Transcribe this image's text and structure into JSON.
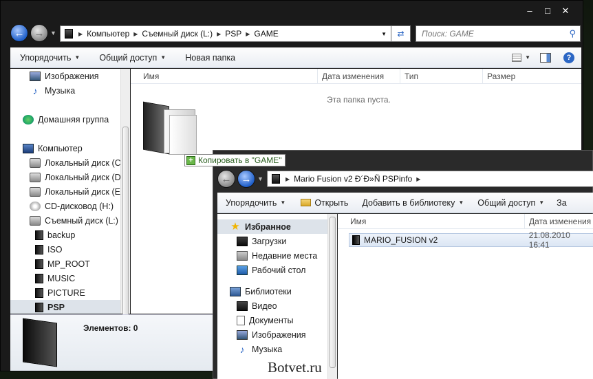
{
  "back_window": {
    "address": {
      "crumbs": [
        "Компьютер",
        "Съемный диск (L:)",
        "PSP",
        "GAME"
      ]
    },
    "search": {
      "placeholder": "Поиск: GAME"
    },
    "toolbar": {
      "organize": "Упорядочить",
      "share": "Общий доступ",
      "new_folder": "Новая папка"
    },
    "nav": {
      "items": [
        {
          "label": "Изображения",
          "icon": "pictures-icon",
          "indent": 1
        },
        {
          "label": "Музыка",
          "icon": "music-icon",
          "indent": 1
        },
        {
          "label": "Домашняя группа",
          "icon": "homegroup-icon",
          "indent": 0
        },
        {
          "label": "Компьютер",
          "icon": "computer-icon",
          "indent": 0
        },
        {
          "label": "Локальный диск (C:)",
          "icon": "drive-icon",
          "indent": 1
        },
        {
          "label": "Локальный диск (D:)",
          "icon": "drive-icon",
          "indent": 1
        },
        {
          "label": "Локальный диск (E:)",
          "icon": "drive-icon",
          "indent": 1
        },
        {
          "label": "CD-дисковод (H:)",
          "icon": "cd-drive-icon",
          "indent": 1
        },
        {
          "label": "Съемный диск (L:)",
          "icon": "drive-icon",
          "indent": 1
        },
        {
          "label": "backup",
          "icon": "folder-icon",
          "indent": 2
        },
        {
          "label": "ISO",
          "icon": "folder-icon",
          "indent": 2
        },
        {
          "label": "MP_ROOT",
          "icon": "folder-icon",
          "indent": 2
        },
        {
          "label": "MUSIC",
          "icon": "folder-icon",
          "indent": 2
        },
        {
          "label": "PICTURE",
          "icon": "folder-icon",
          "indent": 2
        },
        {
          "label": "PSP",
          "icon": "folder-icon",
          "indent": 2,
          "selected": true
        }
      ]
    },
    "columns": [
      "Имя",
      "Дата изменения",
      "Тип",
      "Размер"
    ],
    "empty_text": "Эта папка пуста.",
    "status": {
      "items_label": "Элементов: 0"
    }
  },
  "drag_tooltip": {
    "text": "Копировать в \"GAME\""
  },
  "front_window": {
    "address": {
      "crumbs": [
        "Mario Fusion v2 Ð´Ð»Ñ PSPinfo"
      ]
    },
    "toolbar": {
      "organize": "Упорядочить",
      "open": "Открыть",
      "add_library": "Добавить в библиотеку",
      "share": "Общий доступ",
      "more": "За"
    },
    "nav": {
      "favorites_label": "Избранное",
      "favorites": [
        {
          "label": "Загрузки",
          "icon": "downloads-icon"
        },
        {
          "label": "Недавние места",
          "icon": "recent-places-icon"
        },
        {
          "label": "Рабочий стол",
          "icon": "desktop-icon"
        }
      ],
      "libraries_label": "Библиотеки",
      "libraries": [
        {
          "label": "Видео",
          "icon": "videos-icon"
        },
        {
          "label": "Документы",
          "icon": "documents-icon"
        },
        {
          "label": "Изображения",
          "icon": "pictures-icon"
        },
        {
          "label": "Музыка",
          "icon": "music-icon"
        }
      ]
    },
    "columns": [
      "Имя",
      "Дата изменения"
    ],
    "files": [
      {
        "name": "MARIO_FUSION v2",
        "date": "21.08.2010 16:41"
      }
    ]
  },
  "watermark": "Botvet.ru",
  "colors": {
    "accent": "#2b66c4",
    "selection": "#dde3ea",
    "toolbar_top": "#fdfdfd",
    "toolbar_bottom": "#e9edf3"
  }
}
